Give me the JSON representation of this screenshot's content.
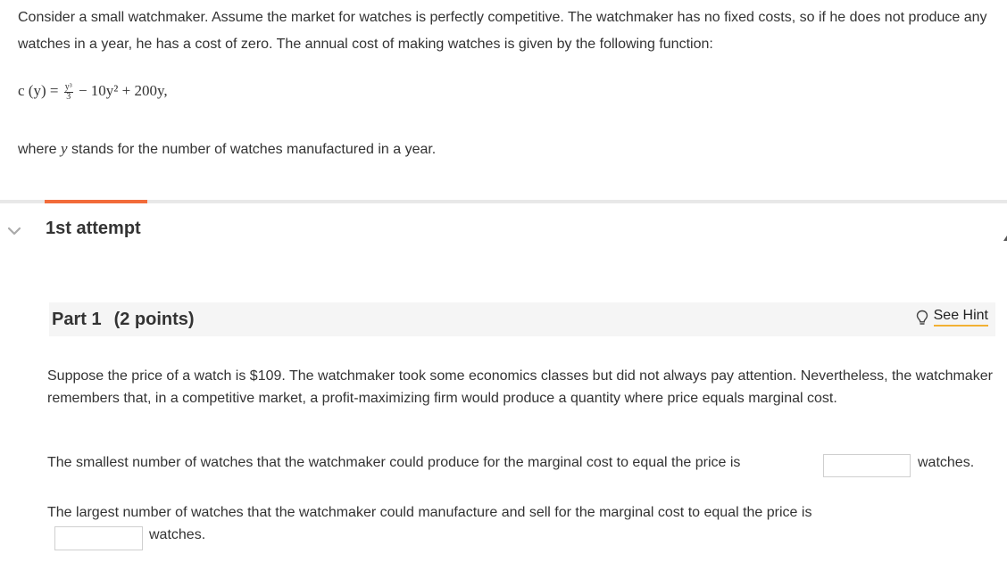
{
  "intro": {
    "text": "Consider a small watchmaker. Assume the market for watches is perfectly competitive. The watchmaker has no fixed costs, so if he does not produce any watches in a year, he has a cost of zero. The annual cost of making watches is given by the following function:"
  },
  "formula": {
    "lhs": "c (y) = ",
    "frac_num": "y³",
    "frac_den": "3",
    "rhs": " − 10y² + 200y,"
  },
  "where": {
    "before": "where ",
    "variable": "y",
    "after": " stands for the number of watches manufactured in a year."
  },
  "attempt": {
    "label": "1st attempt",
    "icon": "chevron-down-icon"
  },
  "part": {
    "title": "Part 1",
    "points": "(2 points)",
    "hint_label": "See Hint",
    "hint_icon": "lightbulb-icon"
  },
  "question": {
    "paragraph": "Suppose the price of a watch is $109. The watchmaker took some economics classes but did not always pay attention. Nevertheless, the watchmaker remembers that, in a competitive market, a profit-maximizing firm would produce a quantity where price equals marginal cost.",
    "q1_text": "The smallest number of watches that the watchmaker could produce for the marginal cost to equal the price is",
    "q1_value": "",
    "q1_unit": "watches.",
    "q2_text": "The largest number of watches that the watchmaker could manufacture and sell for the marginal cost to equal the price is",
    "q2_value": "",
    "q2_unit": "watches."
  },
  "colors": {
    "accent": "#f26b3a",
    "hint_underline": "#f2b134",
    "divider": "#e8e8e8",
    "header_bg": "#f5f5f5"
  }
}
